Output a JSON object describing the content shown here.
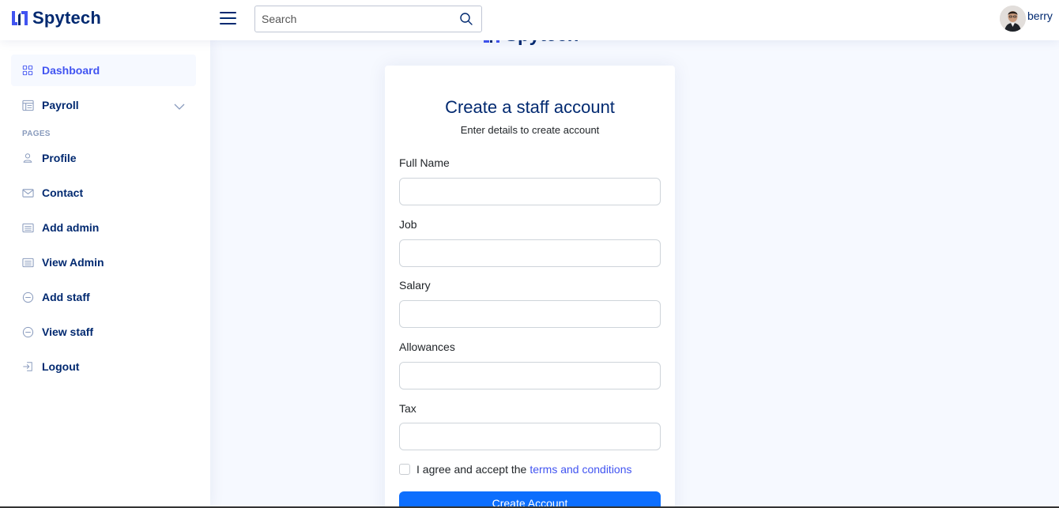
{
  "header": {
    "brand": "Spytech",
    "search": {
      "placeholder": "Search",
      "value": ""
    },
    "user": {
      "name": "berry"
    }
  },
  "sidebar": {
    "items": [
      {
        "label": "Dashboard",
        "icon": "grid-icon",
        "active": true
      },
      {
        "label": "Payroll",
        "icon": "layout-icon",
        "expandable": true
      }
    ],
    "section_heading": "PAGES",
    "pages": [
      {
        "label": "Profile",
        "icon": "person-icon"
      },
      {
        "label": "Contact",
        "icon": "envelope-icon"
      },
      {
        "label": "Add admin",
        "icon": "card-list-icon"
      },
      {
        "label": "View Admin",
        "icon": "card-list-icon"
      },
      {
        "label": "Add staff",
        "icon": "dash-circle-icon"
      },
      {
        "label": "View staff",
        "icon": "dash-circle-icon"
      },
      {
        "label": "Logout",
        "icon": "box-arrow-in-right-icon"
      }
    ]
  },
  "main": {
    "brand": "Spytech",
    "card": {
      "title": "Create a staff account",
      "subtitle": "Enter details to create account",
      "fields": [
        {
          "label": "Full Name",
          "value": ""
        },
        {
          "label": "Job",
          "value": ""
        },
        {
          "label": "Salary",
          "value": ""
        },
        {
          "label": "Allowances",
          "value": ""
        },
        {
          "label": "Tax",
          "value": ""
        }
      ],
      "agree_text": "I agree and accept the",
      "terms_link": "terms and conditions",
      "submit_label": "Create Account"
    }
  },
  "colors": {
    "primary": "#4154f1",
    "navy": "#012970",
    "button": "#0d6efd",
    "background": "#f6f9ff"
  }
}
